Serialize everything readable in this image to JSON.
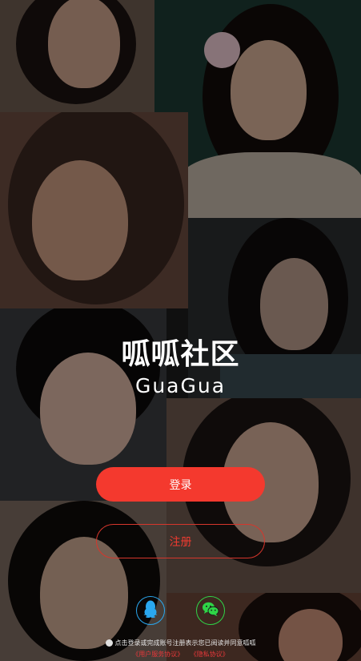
{
  "brand": {
    "name_cn": "呱呱社区",
    "name_en": "GuaGua"
  },
  "actions": {
    "login_label": "登录",
    "register_label": "注册"
  },
  "social": {
    "qq_icon": "qq-penguin-icon",
    "wechat_icon": "wechat-icon",
    "qq_color": "#2aa7ee",
    "wechat_color": "#2fd447"
  },
  "agreement": {
    "text": "点击登录或完成账号注册表示您已阅读并同意呱呱",
    "user_agreement": "《用户服务协议》",
    "privacy_policy": "《隐私协议》"
  },
  "colors": {
    "accent": "#f4392e"
  }
}
